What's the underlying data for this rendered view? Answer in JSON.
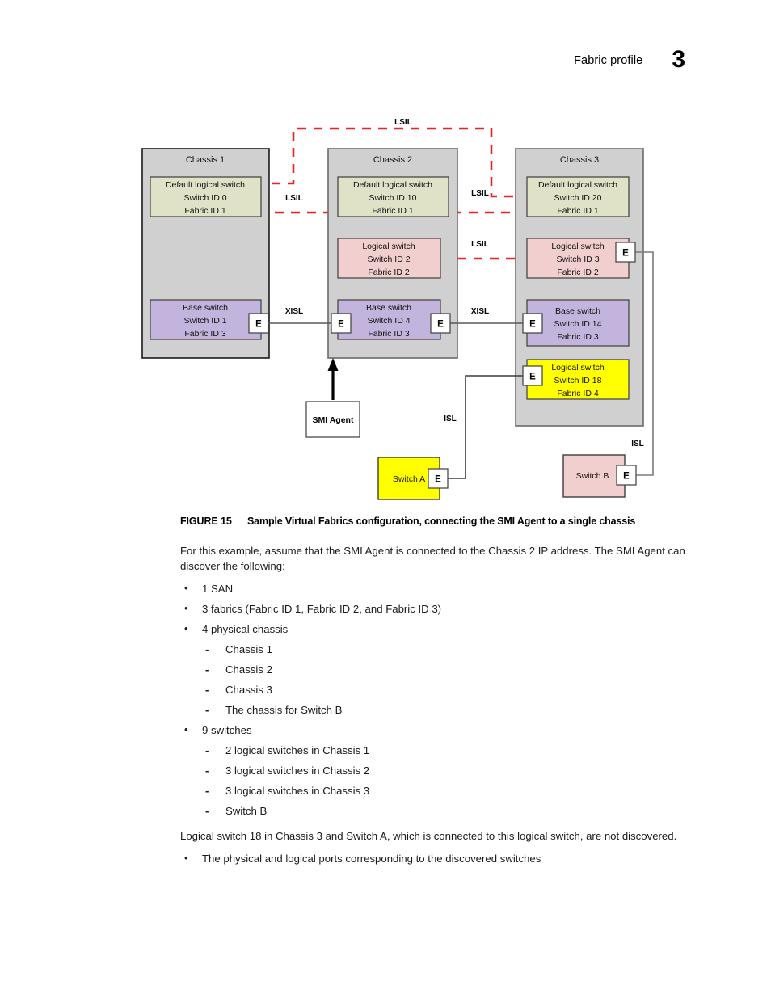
{
  "header": {
    "title": "Fabric profile",
    "chapter": "3"
  },
  "figure": {
    "chassis": [
      {
        "label": "Chassis 1",
        "switches": [
          {
            "name": "Default logical switch",
            "switch_id": "Switch ID 0",
            "fabric_id": "Fabric ID 1",
            "color": "#dfe2c6"
          },
          {
            "name": "Base switch",
            "switch_id": "Switch ID 1",
            "fabric_id": "Fabric ID 3",
            "color": "#c2b4dc"
          }
        ]
      },
      {
        "label": "Chassis 2",
        "switches": [
          {
            "name": "Default logical switch",
            "switch_id": "Switch ID 10",
            "fabric_id": "Fabric ID 1",
            "color": "#dfe2c6"
          },
          {
            "name": "Logical switch",
            "switch_id": "Switch ID 2",
            "fabric_id": "Fabric ID 2",
            "color": "#f2cfcf"
          },
          {
            "name": "Base switch",
            "switch_id": "Switch ID 4",
            "fabric_id": "Fabric ID 3",
            "color": "#c2b4dc"
          }
        ]
      },
      {
        "label": "Chassis 3",
        "switches": [
          {
            "name": "Default logical switch",
            "switch_id": "Switch ID 20",
            "fabric_id": "Fabric ID 1",
            "color": "#dfe2c6"
          },
          {
            "name": "Logical switch",
            "switch_id": "Switch ID 3",
            "fabric_id": "Fabric ID 2",
            "color": "#f2cfcf"
          },
          {
            "name": "Base switch",
            "switch_id": "Switch ID 14",
            "fabric_id": "Fabric ID 3",
            "color": "#c2b4dc"
          },
          {
            "name": "Logical switch",
            "switch_id": "Switch ID 18",
            "fabric_id": "Fabric ID 4",
            "color": "#ffff00"
          }
        ]
      }
    ],
    "standalone": [
      {
        "label": "Switch A",
        "color": "#ffff00"
      },
      {
        "label": "Switch B",
        "color": "#f2cfcf"
      }
    ],
    "agent": {
      "label": "SMI Agent"
    },
    "port_label": "E",
    "link_labels": {
      "lsil": "LSIL",
      "xisl": "XISL",
      "isl": "ISL"
    },
    "colors": {
      "chassis_fill": "#d0d0d0",
      "lsil_line": "#ee2222",
      "link_line": "#595959"
    }
  },
  "caption": {
    "number": "FIGURE 15",
    "title": "Sample Virtual Fabrics configuration, connecting the SMI Agent to a single chassis"
  },
  "body": {
    "intro": "For this example, assume that the SMI Agent is connected to the Chassis 2 IP address. The SMI Agent can discover the following:",
    "bullets": [
      {
        "text": "1 SAN",
        "sub": []
      },
      {
        "text": "3 fabrics (Fabric ID 1, Fabric ID 2, and Fabric ID 3)",
        "sub": []
      },
      {
        "text": "4 physical chassis",
        "sub": [
          "Chassis 1",
          "Chassis 2",
          "Chassis 3",
          "The chassis for Switch B"
        ]
      },
      {
        "text": "9 switches",
        "sub": [
          "2 logical switches in Chassis 1",
          "3 logical switches in Chassis 2",
          "3 logical switches in Chassis 3",
          "Switch B"
        ]
      }
    ],
    "note": "Logical switch 18 in Chassis 3 and Switch A, which is connected to this logical switch, are not discovered.",
    "bullets_after": [
      {
        "text": "The physical and logical ports corresponding to the discovered switches",
        "sub": []
      }
    ]
  }
}
